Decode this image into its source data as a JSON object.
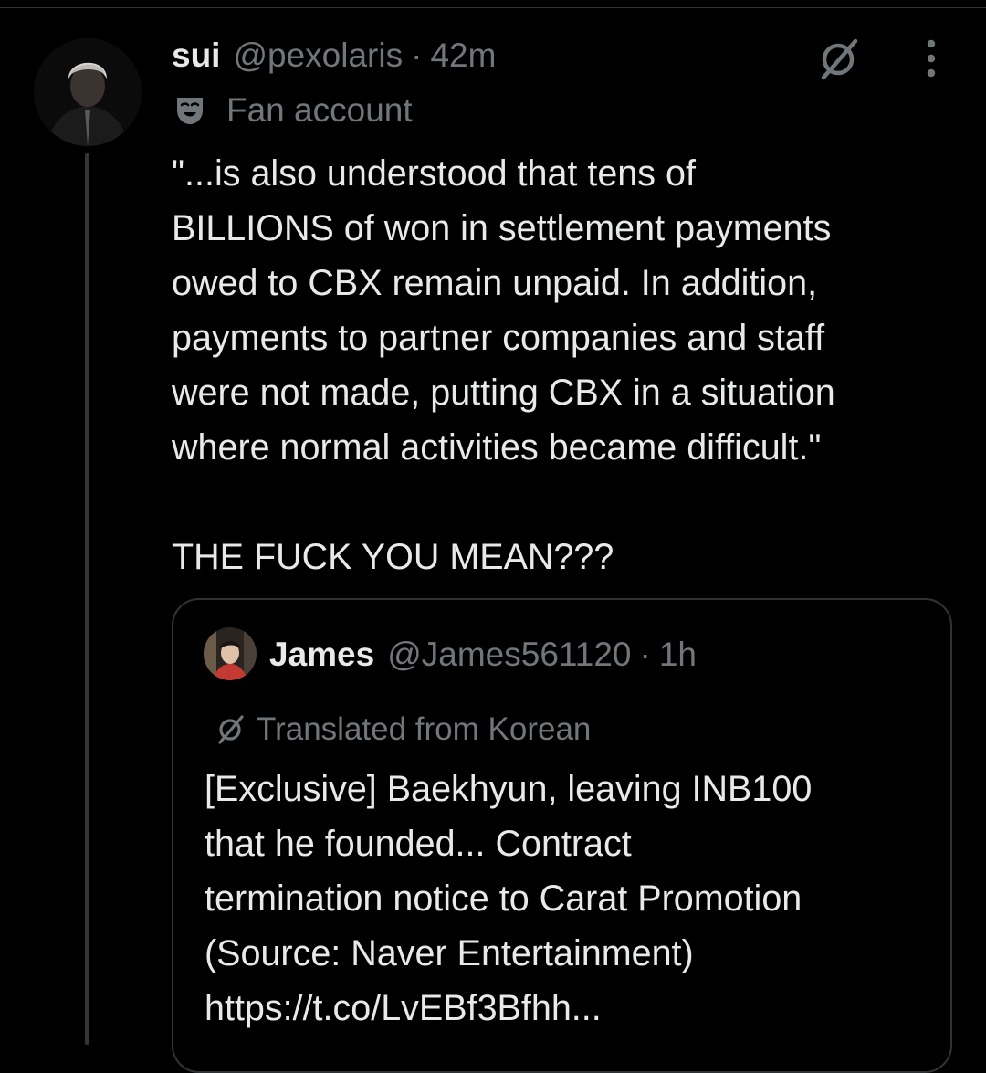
{
  "tweet": {
    "display_name": "sui",
    "handle": "@pexolaris",
    "separator": "·",
    "time": "42m",
    "label": "Fan account",
    "text_lines": [
      "\"...is also understood that tens of",
      "BILLIONS of won in settlement payments",
      "owed to CBX remain unpaid. In addition,",
      "payments to partner companies and staff",
      "were not made, putting CBX in a situation",
      "where normal activities became difficult.\"",
      "THE FUCK YOU MEAN???"
    ]
  },
  "quote": {
    "display_name": "James",
    "handle": "@James561120",
    "separator": "·",
    "time": "1h",
    "translated_label": "Translated from Korean",
    "text_lines": [
      "[Exclusive] Baekhyun, leaving INB100",
      "that he founded... Contract",
      "termination notice to Carat Promotion",
      "(Source: Naver Entertainment)",
      "https://t.co/LvEBf3Bfhh..."
    ]
  },
  "icons": {
    "translate": "translate-icon",
    "more": "more-icon",
    "fan_account": "mask-icon"
  },
  "colors": {
    "background": "#000000",
    "primary_text": "#e7e9ea",
    "secondary_text": "#71767b",
    "border": "#2f3336"
  }
}
